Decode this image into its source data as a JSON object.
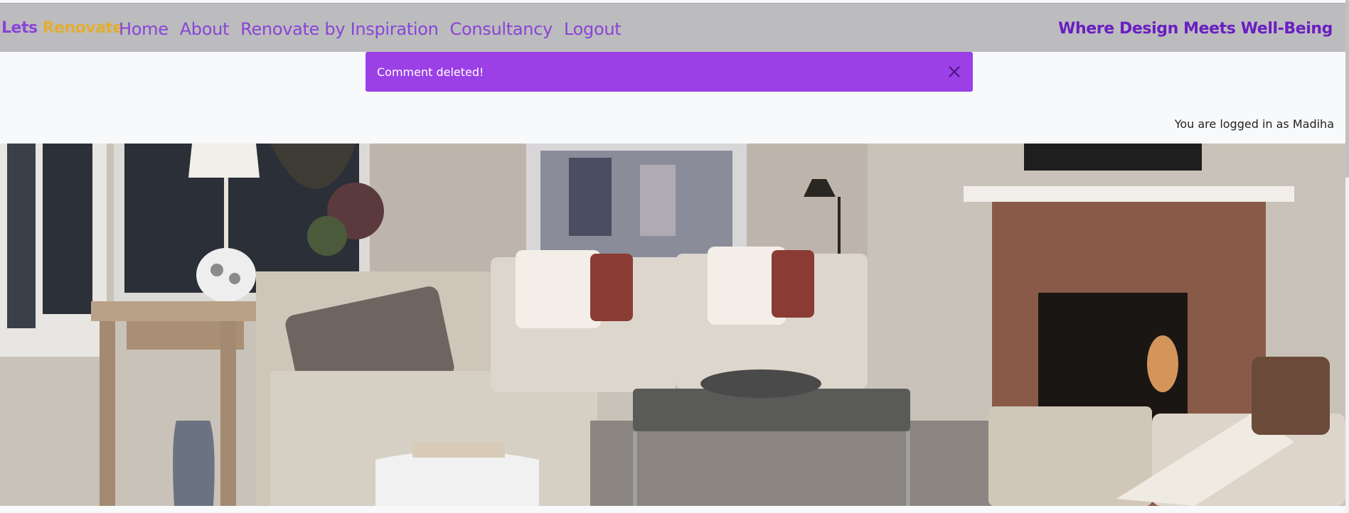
{
  "navbar": {
    "brand_part1": "Lets",
    "brand_part2": "Renovate",
    "links": [
      {
        "label": "Home"
      },
      {
        "label": "About"
      },
      {
        "label": "Renovate by Inspiration"
      },
      {
        "label": "Consultancy"
      },
      {
        "label": "Logout"
      }
    ],
    "tagline": "Where Design Meets Well-Being"
  },
  "alert": {
    "message": "Comment deleted!",
    "close_icon": "close-icon"
  },
  "user": {
    "status": "You are logged in as Madiha"
  },
  "colors": {
    "brand_purple": "#8a44d6",
    "brand_orange": "#e3ad33",
    "tagline_purple": "#6a1ec2",
    "alert_bg": "#9b3fe6",
    "navbar_bg": "#bcbcbe"
  }
}
